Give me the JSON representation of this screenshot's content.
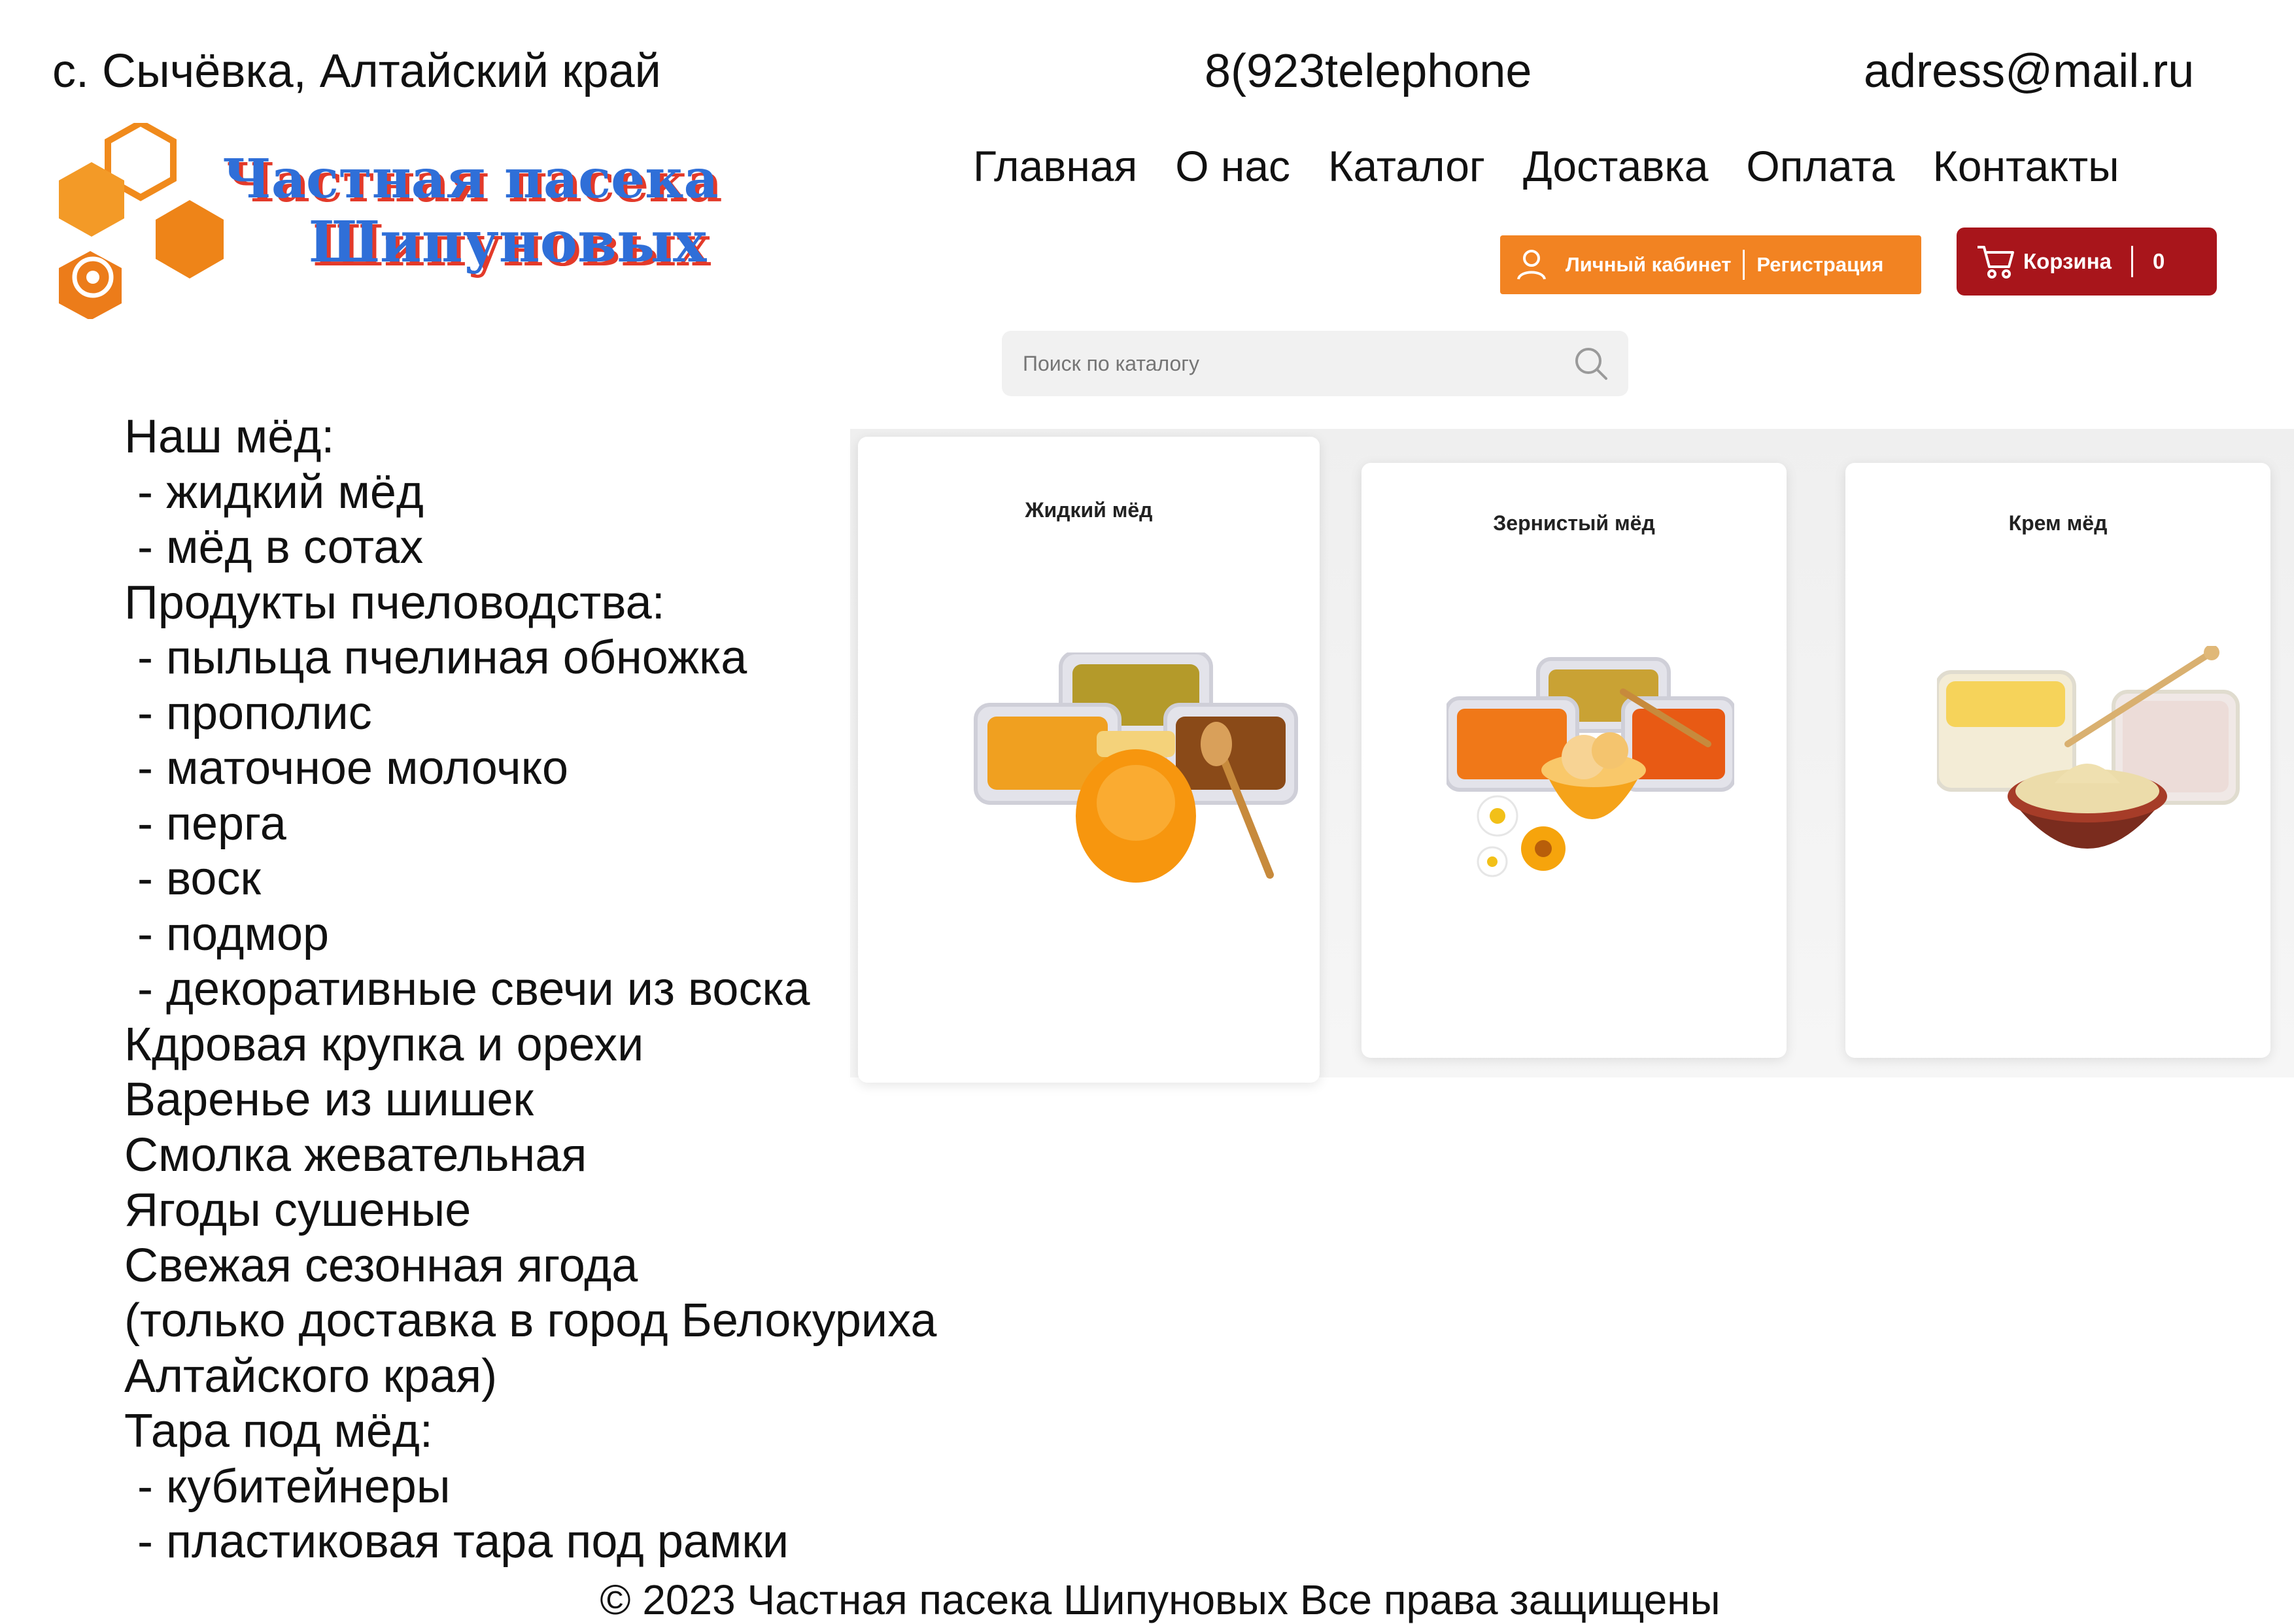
{
  "header": {
    "location": "с. Сычёвка, Алтайский край",
    "phone": "8(923telephone",
    "email": "adress@mail.ru"
  },
  "logo": {
    "line1": "Частная пасека",
    "line2": "Шипуновых"
  },
  "nav": {
    "items": [
      "Главная",
      "О нас",
      "Каталог",
      "Доставка",
      "Оплата",
      "Контакты"
    ]
  },
  "account": {
    "login_label": "Личный кабинет",
    "register_label": "Регистрация"
  },
  "cart": {
    "label": "Корзина",
    "count": "0"
  },
  "search": {
    "placeholder": "Поиск по каталогу"
  },
  "products": {
    "lines": [
      "Наш мёд:",
      " - жидкий мёд",
      " - мёд в сотах",
      "Продукты пчеловодства:",
      " - пыльца пчелиная обножка",
      " - прополис",
      " - маточное молочко",
      " - перга",
      " - воск",
      " - подмор",
      " - декоративные свечи из воска",
      "Кдровая крупка и орехи",
      "Варенье из шишек",
      "Смолка жевательная",
      "Ягоды сушеные",
      "Свежая сезонная ягода",
      "(только доставка в город Белокуриха",
      "Алтайского края)",
      "Тара под мёд:",
      " - кубитейнеры",
      " - пластиковая тара под рамки"
    ]
  },
  "catalog": {
    "cards": [
      {
        "title": "Жидкий мёд"
      },
      {
        "title": "Зернистый мёд"
      },
      {
        "title": "Крем мёд"
      }
    ]
  },
  "footer": {
    "text": "© 2023 Частная пасека Шипуновых  Все права защищены"
  },
  "colors": {
    "account_orange": "#f28322",
    "cart_red": "#a8151b",
    "logo_blue": "#2f6fd8",
    "logo_red": "#e33a2a",
    "honeycomb_orange": "#f08a1c"
  }
}
